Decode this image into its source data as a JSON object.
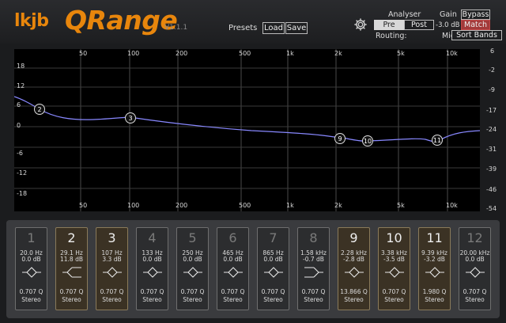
{
  "header": {
    "logo_left": "lkjb",
    "logo_main": "QRange",
    "version": "V1.1.1",
    "presets_label": "Presets",
    "load_label": "Load",
    "save_label": "Save",
    "analyser_label": "Analyser",
    "pre_label": "Pre",
    "post_label": "Post",
    "gain_label": "Gain",
    "gain_value": "-3.0 dB",
    "bypass_label": "Bypass",
    "match_label": "Match",
    "routing_label": "Routing:",
    "routing_value": "Mid",
    "sort_bands_label": "Sort Bands"
  },
  "graph": {
    "freq_labels": [
      "50",
      "100",
      "200",
      "500",
      "1k",
      "2k",
      "5k",
      "10k"
    ],
    "left_db_labels": [
      "18",
      "12",
      "6",
      "0",
      "-6",
      "-12",
      "-18"
    ],
    "right_db_labels": [
      "6",
      "-2",
      "-9",
      "-17",
      "-24",
      "-31",
      "-39",
      "-46",
      "-54"
    ],
    "markers": [
      "2",
      "3",
      "9",
      "10",
      "11"
    ]
  },
  "bands": [
    {
      "num": "1",
      "freq": "20.0 Hz",
      "gain": "0.0 dB",
      "q": "0.707 Q",
      "mode": "Stereo",
      "active": false,
      "shape": "bell"
    },
    {
      "num": "2",
      "freq": "29.1 Hz",
      "gain": "11.8 dB",
      "q": "0.707 Q",
      "mode": "Stereo",
      "active": true,
      "shape": "lowshelf"
    },
    {
      "num": "3",
      "freq": "107 Hz",
      "gain": "3.3 dB",
      "q": "0.707 Q",
      "mode": "Stereo",
      "active": true,
      "shape": "bell"
    },
    {
      "num": "4",
      "freq": "133 Hz",
      "gain": "0.0 dB",
      "q": "0.707 Q",
      "mode": "Stereo",
      "active": false,
      "shape": "bell"
    },
    {
      "num": "5",
      "freq": "250 Hz",
      "gain": "0.0 dB",
      "q": "0.707 Q",
      "mode": "Stereo",
      "active": false,
      "shape": "bell"
    },
    {
      "num": "6",
      "freq": "465 Hz",
      "gain": "0.0 dB",
      "q": "0.707 Q",
      "mode": "Stereo",
      "active": false,
      "shape": "bell"
    },
    {
      "num": "7",
      "freq": "865 Hz",
      "gain": "0.0 dB",
      "q": "0.707 Q",
      "mode": "Stereo",
      "active": false,
      "shape": "bell"
    },
    {
      "num": "8",
      "freq": "1.58 kHz",
      "gain": "-0.7 dB",
      "q": "0.707 Q",
      "mode": "Stereo",
      "active": false,
      "shape": "highshelf"
    },
    {
      "num": "9",
      "freq": "2.28 kHz",
      "gain": "-2.8 dB",
      "q": "13.866 Q",
      "mode": "Stereo",
      "active": true,
      "shape": "bell"
    },
    {
      "num": "10",
      "freq": "3.38 kHz",
      "gain": "-3.5 dB",
      "q": "0.707 Q",
      "mode": "Stereo",
      "active": true,
      "shape": "bell"
    },
    {
      "num": "11",
      "freq": "9.39 kHz",
      "gain": "-3.2 dB",
      "q": "1.980 Q",
      "mode": "Stereo",
      "active": true,
      "shape": "bell"
    },
    {
      "num": "12",
      "freq": "20.00 kHz",
      "gain": "0.0 dB",
      "q": "0.707 Q",
      "mode": "Stereo",
      "active": false,
      "shape": "bell"
    }
  ]
}
